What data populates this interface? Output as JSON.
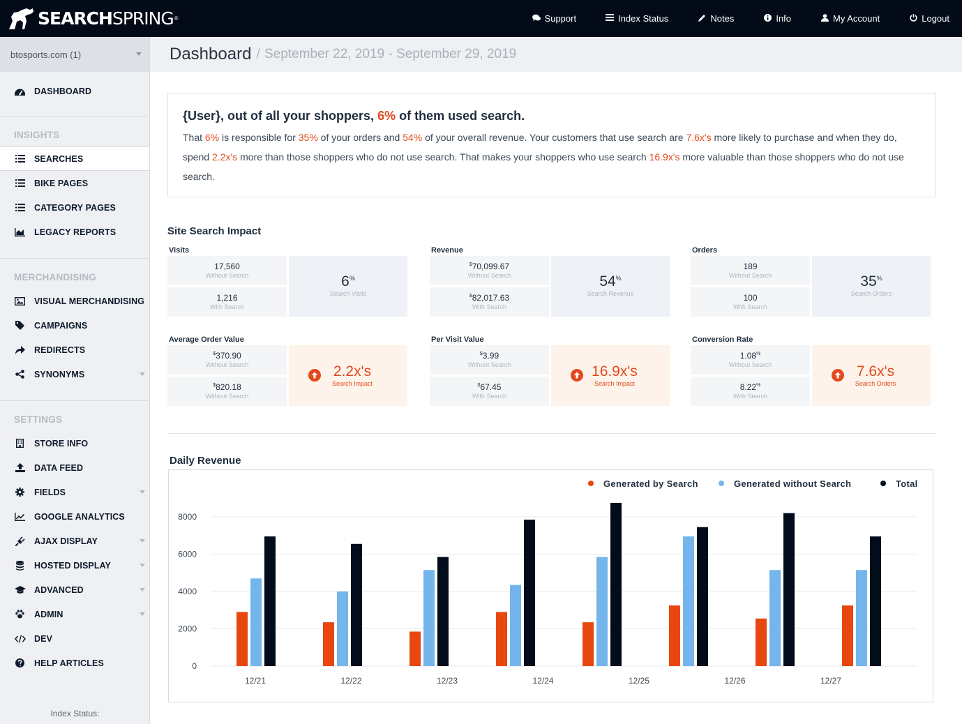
{
  "app": {
    "brand_bold": "SEARCH",
    "brand_light": "SPRING",
    "brand_tm": "®"
  },
  "topnav": [
    {
      "label": "Support",
      "icon": "comments-icon"
    },
    {
      "label": "Index Status",
      "icon": "list-icon"
    },
    {
      "label": "Notes",
      "icon": "pencil-icon"
    },
    {
      "label": "Info",
      "icon": "info-icon"
    },
    {
      "label": "My Account",
      "icon": "user-icon"
    },
    {
      "label": "Logout",
      "icon": "power-icon"
    }
  ],
  "sidebar": {
    "site": "btosports.com (1)",
    "dashboard": "DASHBOARD",
    "sections": {
      "insights": "INSIGHTS",
      "merchandising": "MERCHANDISING",
      "settings": "SETTINGS"
    },
    "insights_items": [
      "SEARCHES",
      "BIKE PAGES",
      "CATEGORY PAGES",
      "LEGACY REPORTS"
    ],
    "merch_items": [
      "VISUAL MERCHANDISING",
      "CAMPAIGNS",
      "REDIRECTS",
      "SYNONYMS"
    ],
    "settings_items": [
      "STORE INFO",
      "DATA FEED",
      "FIELDS",
      "GOOGLE ANALYTICS",
      "AJAX DISPLAY",
      "HOSTED DISPLAY",
      "ADVANCED",
      "ADMIN",
      "DEV",
      "HELP ARTICLES"
    ],
    "index_status": "Index Status:"
  },
  "header": {
    "title": "Dashboard",
    "separator": "/",
    "range": "September 22, 2019 -  September 29, 2019"
  },
  "summary": {
    "h1": "{User}, out of all your shoppers, ",
    "h_pct": "6%",
    "h2": " of them used search.",
    "p1": "That ",
    "v1": "6%",
    "p2": " is responsible for ",
    "v2": "35%",
    "p3": " of your orders and ",
    "v3": "54%",
    "p4": " of your overall revenue. Your customers that use search are ",
    "v4": "7.6x's",
    "p5": " more likely to purchase and when they do, spend ",
    "v5": "2.2x's",
    "p6": " more than those shoppers who do not use search. That makes your shoppers who use search ",
    "v6": "16.9x's",
    "p7": " more valuable than those shoppers who do not use search."
  },
  "impact": {
    "title": "Site Search Impact",
    "metrics": [
      {
        "label": "Visits",
        "top_pre": "",
        "top": "17,560",
        "top_post": "",
        "top_sub": "Without Search",
        "bot_pre": "",
        "bot": "1,216",
        "bot_post": "",
        "bot_sub": "With Search",
        "big": "6",
        "big_sup": "%",
        "big_sub": "Search Visits",
        "orange": false
      },
      {
        "label": "Revenue",
        "top_pre": "$",
        "top": "70,099.67",
        "top_post": "",
        "top_sub": "Without Search",
        "bot_pre": "$",
        "bot": "82,017.63",
        "bot_post": "",
        "bot_sub": "With Search",
        "big": "54",
        "big_sup": "%",
        "big_sub": "Search Revenue",
        "orange": false
      },
      {
        "label": "Orders",
        "top_pre": "",
        "top": "189",
        "top_post": "",
        "top_sub": "Without Search",
        "bot_pre": "",
        "bot": "100",
        "bot_post": "",
        "bot_sub": "With Search",
        "big": "35",
        "big_sup": "%",
        "big_sub": "Search Orders",
        "orange": false
      },
      {
        "label": "Average Order Value",
        "top_pre": "$",
        "top": "370.90",
        "top_post": "",
        "top_sub": "Without Search",
        "bot_pre": "$",
        "bot": "820.18",
        "bot_post": "",
        "bot_sub": "Without Search",
        "big": "2.2x's",
        "big_sup": "",
        "big_sub": "Search Impact",
        "orange": true
      },
      {
        "label": "Per Visit Value",
        "top_pre": "$",
        "top": "3.99",
        "top_post": "",
        "top_sub": "Without Search",
        "bot_pre": "$",
        "bot": "67.45",
        "bot_post": "",
        "bot_sub": "With Search",
        "big": "16.9x's",
        "big_sup": "",
        "big_sub": "Search Impact",
        "orange": true
      },
      {
        "label": "Conversion Rate",
        "top_pre": "",
        "top": "1.08",
        "top_post": "%",
        "top_sub": "Without Search",
        "bot_pre": "",
        "bot": "8.22",
        "bot_post": "%",
        "bot_sub": "With Search",
        "big": "7.6x's",
        "big_sup": "",
        "big_sub": "Search Orders",
        "orange": true
      }
    ]
  },
  "chart_data": {
    "type": "bar",
    "title": "Daily Revenue",
    "categories": [
      "12/21",
      "12/22",
      "12/23",
      "12/24",
      "12/25",
      "12/26",
      "12/27"
    ],
    "series": [
      {
        "name": "Generated by Search",
        "color": "#e8470f",
        "values": [
          2900,
          2350,
          1850,
          2900,
          2350,
          3250,
          2550,
          3250
        ]
      },
      {
        "name": "Generated without Search",
        "color": "#74b6ec",
        "values": [
          4700,
          4000,
          5150,
          4350,
          5850,
          6950,
          5150,
          5150
        ]
      },
      {
        "name": "Total",
        "color": "#020d1c",
        "values": [
          6950,
          6550,
          5850,
          7850,
          8750,
          7450,
          8200,
          6950
        ]
      }
    ],
    "ylim": [
      0,
      8000
    ],
    "yticks": [
      "0",
      "2000",
      "4000",
      "6000",
      "8000"
    ],
    "legend": "top-right",
    "grid": true
  }
}
